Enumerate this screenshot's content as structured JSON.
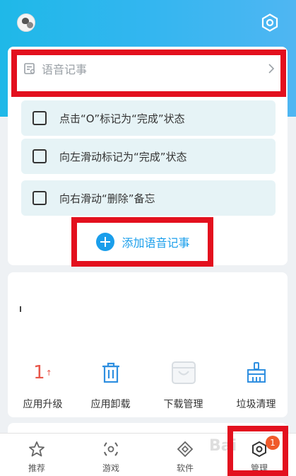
{
  "header": {
    "avatar_icon": "avatar",
    "settings_icon": "gear-icon"
  },
  "voice_note": {
    "title": "语音记事",
    "chevron": "›",
    "items": [
      {
        "text": "点击“O”标记为“完成”状态",
        "checked": false
      },
      {
        "text": "向左滑动标记为“完成”状态",
        "checked": false
      },
      {
        "text": "向右滑动“删除”备忘",
        "checked": false
      }
    ],
    "add_label": "添加语音记事"
  },
  "tools": {
    "items": [
      {
        "label": "应用升级",
        "count": "1",
        "count_arrow": "↑",
        "icon": "upgrade-icon"
      },
      {
        "label": "应用卸载",
        "icon": "trash-icon"
      },
      {
        "label": "下载管理",
        "icon": "download-bag-icon"
      },
      {
        "label": "垃圾清理",
        "icon": "broom-icon"
      }
    ]
  },
  "bottom_nav": {
    "items": [
      {
        "label": "推荐",
        "icon": "star-icon"
      },
      {
        "label": "游戏",
        "icon": "gamepad-icon"
      },
      {
        "label": "软件",
        "icon": "apps-icon"
      },
      {
        "label": "管理",
        "icon": "manage-icon"
      }
    ],
    "badge": "1"
  },
  "watermark": "Bai",
  "colors": {
    "accent": "#1a9eeb",
    "header": "#33b6f0",
    "highlight_frame": "#e3101e",
    "badge": "#f05a2a"
  }
}
